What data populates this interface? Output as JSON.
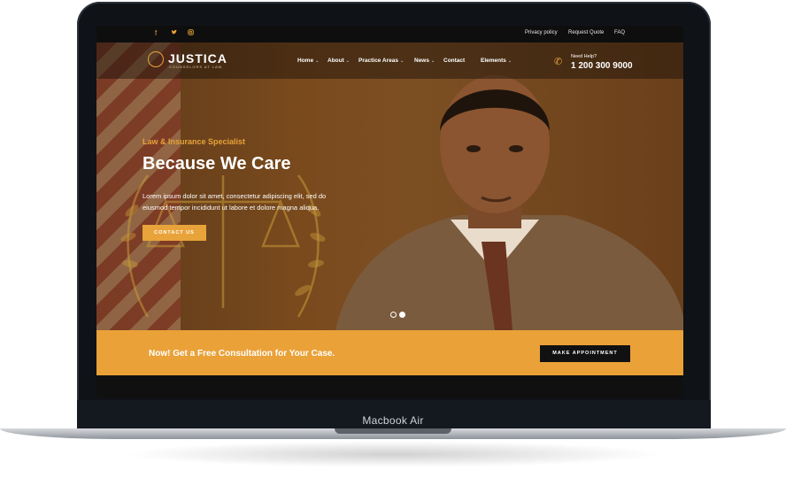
{
  "device": {
    "model_label": "Macbook Air"
  },
  "topbar": {
    "social_icons": [
      "facebook-icon",
      "twitter-icon",
      "instagram-icon"
    ],
    "links": [
      "Privacy policy",
      "Request Quote",
      "FAQ"
    ]
  },
  "brand": {
    "name": "JUSTICA",
    "tagline": "COUNSELORS AT LAW"
  },
  "nav": {
    "items": [
      {
        "label": "Home",
        "has_dropdown": true
      },
      {
        "label": "About",
        "has_dropdown": true
      },
      {
        "label": "Practice Areas",
        "has_dropdown": true
      },
      {
        "label": "News",
        "has_dropdown": true
      },
      {
        "label": "Contact",
        "has_dropdown": false
      },
      {
        "label": "Elements",
        "has_dropdown": true
      }
    ],
    "help_label": "Need Help?",
    "phone": "1 200 300 9000"
  },
  "hero": {
    "kicker": "Law & Insurance Specialist",
    "headline": "Because We Care",
    "body": "Lorem ipsum dolor sit amet, consectetur adipiscing elit, sed do eiusmod tempor incididunt ut labore et dolore magna aliqua.",
    "cta_label": "CONTACT US",
    "slide_count": 2,
    "active_slide": 2
  },
  "band": {
    "text": "Now! Get a Free Consultation for Your Case.",
    "button_label": "MAKE APPOINTMENT"
  },
  "colors": {
    "accent": "#eaa138",
    "dark": "#111111",
    "white": "#ffffff"
  }
}
